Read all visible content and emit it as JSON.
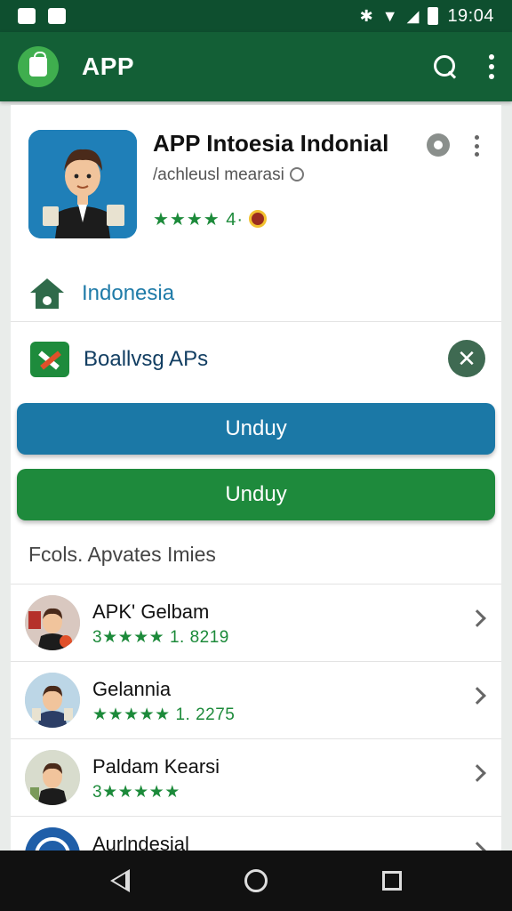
{
  "status_bar": {
    "time": "19:04"
  },
  "app_bar": {
    "title": "APP"
  },
  "app": {
    "title": "APP Intoesia Indonial",
    "subtitle": "/achleusl mearasi",
    "rating_text": "★★★★ 4·"
  },
  "country": {
    "label": "Indonesia"
  },
  "category": {
    "label": "Boallvsg APs",
    "close_glyph": "✕"
  },
  "buttons": {
    "primary_label": "Unduy",
    "secondary_label": "Unduy"
  },
  "section": {
    "title": "Fcols. Apvates Imies"
  },
  "list": [
    {
      "name": "APK' Gelbam",
      "rating": "3★★★★ 1. 8219"
    },
    {
      "name": "Gelannia",
      "rating": "★★★★★ 1. 2275"
    },
    {
      "name": "Paldam Kearsi",
      "rating": "3★★★★★"
    },
    {
      "name": "Aurlndesial",
      "rating": ""
    }
  ],
  "colors": {
    "status_bar": "#0e4f2f",
    "app_bar": "#135f36",
    "primary_button": "#1b78a6",
    "secondary_button": "#1e8a3c",
    "star": "#1c8a3a",
    "link": "#1f7ba8"
  }
}
